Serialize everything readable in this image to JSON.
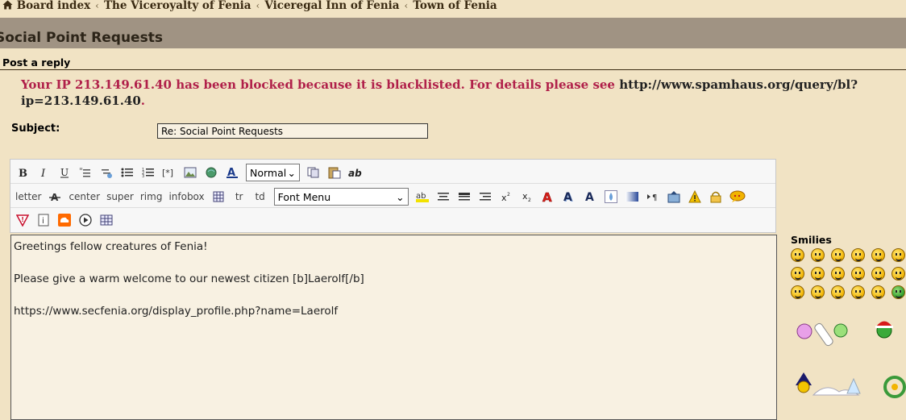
{
  "breadcrumbs": [
    "Board index",
    "The Viceroyalty of Fenia",
    "Viceregal Inn of Fenia",
    "Town of Fenia"
  ],
  "topic_title": "Social Point Requests",
  "form_heading": "Post a reply",
  "error": {
    "text": "Your IP 213.149.61.40 has been blocked because it is blacklisted. For details please see ",
    "link": "http://www.spamhaus.org/query/bl?ip=213.149.61.40",
    "tail": "."
  },
  "subject": {
    "label": "Subject:",
    "value": "Re: Social Point Requests"
  },
  "toolbar": {
    "row1": [
      "bold-icon",
      "italic-icon",
      "underline-icon",
      "quote-icon",
      "code-icon",
      "bulleted-list-icon",
      "numbered-list-icon",
      "list-item-icon",
      "image-icon",
      "link-icon",
      "font-color-icon"
    ],
    "format_select": "Normal",
    "row1_tail": [
      "copy-icon",
      "paste-icon",
      "remove-format-icon"
    ],
    "row2_text": [
      "letter",
      "center",
      "super",
      "rimg",
      "infobox",
      "tr",
      "td"
    ],
    "font_menu": "Font Menu",
    "row3": [
      "warning-flag-icon",
      "info-icon",
      "soundcloud-icon",
      "play-icon",
      "table-icon"
    ]
  },
  "editor": {
    "lines": [
      "Greetings fellow creatures of Fenia!",
      "",
      "Please give a warm welcome to our newest citizen [b]Laerolf[/b]",
      "",
      "https://www.secfenia.org/display_profile.php?name=Laerolf"
    ]
  },
  "smilies": {
    "label": "Smilies"
  },
  "colors": {
    "page_bg": "#f1e3c4",
    "title_bar": "#a09383",
    "error_text": "#b0204a"
  }
}
